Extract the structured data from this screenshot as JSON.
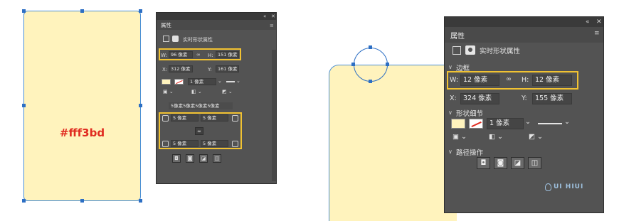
{
  "left_canvas": {
    "fill_label": "#fff3bd",
    "fill_color": "#fff3bd"
  },
  "small_panel": {
    "collapse": "«",
    "close": "✕",
    "menu": "≡",
    "tab": "属性",
    "section_title": "实时形状属性",
    "w_label": "W:",
    "w_value": "96 像素",
    "h_label": "H:",
    "h_value": "151 像素",
    "x_label": "X:",
    "x_value": "312 像素",
    "y_label": "Y:",
    "y_value": "161 像素",
    "stroke_width": "1 像素",
    "radius_summary": "5像素5像素5像素5像素",
    "corner_tl": "5 像素",
    "corner_tr": "5 像素",
    "corner_bl": "5 像素",
    "corner_br": "5 像素"
  },
  "large_panel": {
    "collapse": "«",
    "close": "✕",
    "menu": "≡",
    "tab": "属性",
    "section_title": "实时形状属性",
    "bounds_header": "边框",
    "w_label": "W:",
    "w_value": "12 像素",
    "h_label": "H:",
    "h_value": "12 像素",
    "x_label": "X:",
    "x_value": "324 像素",
    "y_label": "Y:",
    "y_value": "155 像素",
    "shape_header": "形状细节",
    "stroke_width": "1 像素",
    "path_header": "路径操作"
  },
  "watermark": "UI HIUI",
  "colors": {
    "accent_yellow": "#f1c232",
    "selection_blue": "#2d6fc4",
    "panel_bg": "#535353"
  }
}
